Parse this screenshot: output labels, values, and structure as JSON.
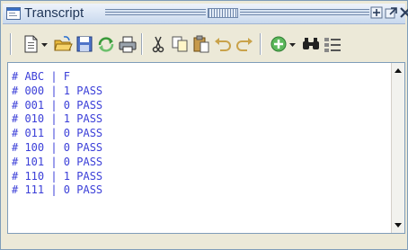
{
  "window": {
    "title": "Transcript"
  },
  "toolbar": {
    "buttons": [
      {
        "name": "new-file-icon"
      },
      {
        "name": "dropdown-arrow-icon"
      },
      {
        "name": "open-folder-icon"
      },
      {
        "name": "save-icon"
      },
      {
        "name": "reload-icon"
      },
      {
        "name": "print-icon"
      },
      {
        "name": "cut-icon"
      },
      {
        "name": "copy-icon"
      },
      {
        "name": "paste-icon"
      },
      {
        "name": "undo-icon"
      },
      {
        "name": "redo-icon"
      },
      {
        "name": "add-icon"
      },
      {
        "name": "find-icon"
      },
      {
        "name": "list-icon"
      }
    ]
  },
  "transcript": {
    "lines": [
      "# ABC | F",
      "# 000 | 1 PASS",
      "# 001 | 0 PASS",
      "# 010 | 1 PASS",
      "# 011 | 0 PASS",
      "# 100 | 0 PASS",
      "# 101 | 0 PASS",
      "# 110 | 1 PASS",
      "# 111 | 0 PASS"
    ]
  },
  "colors": {
    "transcript_text": "#3b3fd8",
    "title_text": "#1f3557"
  }
}
